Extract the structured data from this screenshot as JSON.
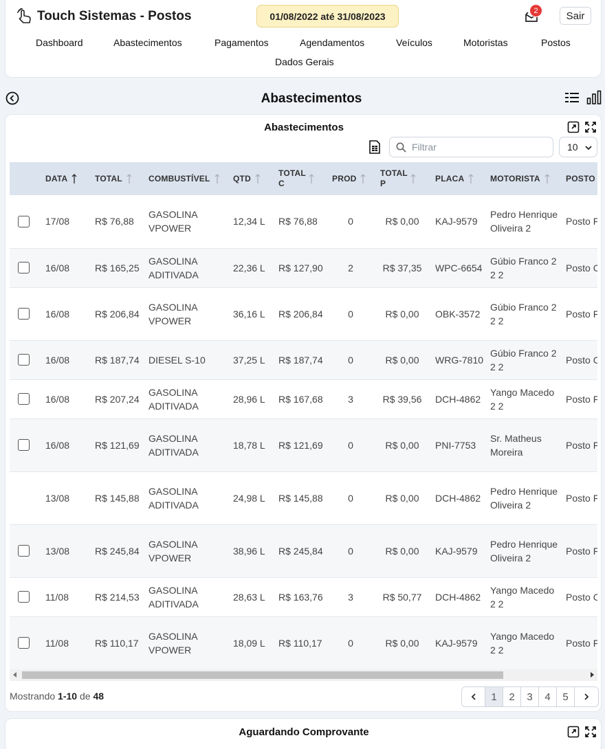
{
  "header": {
    "app_title": "Touch Sistemas - Postos",
    "period": "01/08/2022 até 31/08/2023",
    "notification_count": "2",
    "logout_label": "Sair"
  },
  "nav": {
    "items": [
      "Dashboard",
      "Abastecimentos",
      "Pagamentos",
      "Agendamentos",
      "Veículos",
      "Motoristas",
      "Postos",
      "Dados Gerais"
    ]
  },
  "page": {
    "title": "Abastecimentos"
  },
  "table_card": {
    "title": "Abastecimentos",
    "filter_placeholder": "Filtrar",
    "page_size": "10",
    "columns": [
      "DATA",
      "TOTAL",
      "COMBUSTÍVEL",
      "QTD",
      "TOTAL C",
      "PROD",
      "TOTAL P",
      "PLACA",
      "MOTORISTA",
      "POSTO"
    ],
    "rows": [
      {
        "checkbox": true,
        "data": "17/08",
        "total": "R$ 76,88",
        "combustivel": "GASOLINA VPOWER",
        "qtd": "12,34 L",
        "total_c": "R$ 76,88",
        "prod": "0",
        "total_p": "R$ 0,00",
        "placa": "KAJ-9579",
        "motorista": "Pedro Henrique Oliveira 2",
        "posto": "Posto Fernan"
      },
      {
        "checkbox": true,
        "data": "16/08",
        "total": "R$ 165,25",
        "combustivel": "GASOLINA ADITIVADA",
        "qtd": "22,36 L",
        "total_c": "R$ 127,90",
        "prod": "2",
        "total_p": "R$ 37,35",
        "placa": "WPC-6654",
        "motorista": "Gúbio Franco 2 2 2",
        "posto": "Posto C"
      },
      {
        "checkbox": true,
        "data": "16/08",
        "total": "R$ 206,84",
        "combustivel": "GASOLINA VPOWER",
        "qtd": "36,16 L",
        "total_c": "R$ 206,84",
        "prod": "0",
        "total_p": "R$ 0,00",
        "placa": "OBK-3572",
        "motorista": "Gúbio Franco 2 2 2",
        "posto": "Posto Fernan Joinvill"
      },
      {
        "checkbox": true,
        "data": "16/08",
        "total": "R$ 187,74",
        "combustivel": "DIESEL S-10",
        "qtd": "37,25 L",
        "total_c": "R$ 187,74",
        "prod": "0",
        "total_p": "R$ 0,00",
        "placa": "WRG-7810",
        "motorista": "Gúbio Franco 2 2 2",
        "posto": "Posto C"
      },
      {
        "checkbox": true,
        "data": "16/08",
        "total": "R$ 207,24",
        "combustivel": "GASOLINA ADITIVADA",
        "qtd": "28,96 L",
        "total_c": "R$ 167,68",
        "prod": "3",
        "total_p": "R$ 39,56",
        "placa": "DCH-4862",
        "motorista": "Yango Macedo 2 2",
        "posto": "Posto Fernan"
      },
      {
        "checkbox": true,
        "data": "16/08",
        "total": "R$ 121,69",
        "combustivel": "GASOLINA ADITIVADA",
        "qtd": "18,78 L",
        "total_c": "R$ 121,69",
        "prod": "0",
        "total_p": "R$ 0,00",
        "placa": "PNI-7753",
        "motorista": "Sr. Matheus Moreira",
        "posto": "Posto Fernan Joinvill"
      },
      {
        "checkbox": false,
        "data": "13/08",
        "total": "R$ 145,88",
        "combustivel": "GASOLINA ADITIVADA",
        "qtd": "24,98 L",
        "total_c": "R$ 145,88",
        "prod": "0",
        "total_p": "R$ 0,00",
        "placa": "DCH-4862",
        "motorista": "Pedro Henrique Oliveira 2",
        "posto": "Posto Fernan"
      },
      {
        "checkbox": true,
        "data": "13/08",
        "total": "R$ 245,84",
        "combustivel": "GASOLINA VPOWER",
        "qtd": "38,96 L",
        "total_c": "R$ 245,84",
        "prod": "0",
        "total_p": "R$ 0,00",
        "placa": "KAJ-9579",
        "motorista": "Pedro Henrique Oliveira 2",
        "posto": "Posto Fernan Joinvill"
      },
      {
        "checkbox": true,
        "data": "11/08",
        "total": "R$ 214,53",
        "combustivel": "GASOLINA ADITIVADA",
        "qtd": "28,63 L",
        "total_c": "R$ 163,76",
        "prod": "3",
        "total_p": "R$ 50,77",
        "placa": "DCH-4862",
        "motorista": "Yango Macedo 2 2",
        "posto": "Posto C"
      },
      {
        "checkbox": true,
        "data": "11/08",
        "total": "R$ 110,17",
        "combustivel": "GASOLINA VPOWER",
        "qtd": "18,09 L",
        "total_c": "R$ 110,17",
        "prod": "0",
        "total_p": "R$ 0,00",
        "placa": "KAJ-9579",
        "motorista": "Yango Macedo 2 2",
        "posto": "Posto Fernan Joinvill"
      }
    ],
    "showing_prefix": "Mostrando",
    "showing_range": "1-10",
    "showing_of": "de",
    "showing_total": "48",
    "pages": [
      "1",
      "2",
      "3",
      "4",
      "5"
    ],
    "current_page": "1"
  },
  "bottom_card": {
    "title": "Aguardando Comprovante"
  }
}
